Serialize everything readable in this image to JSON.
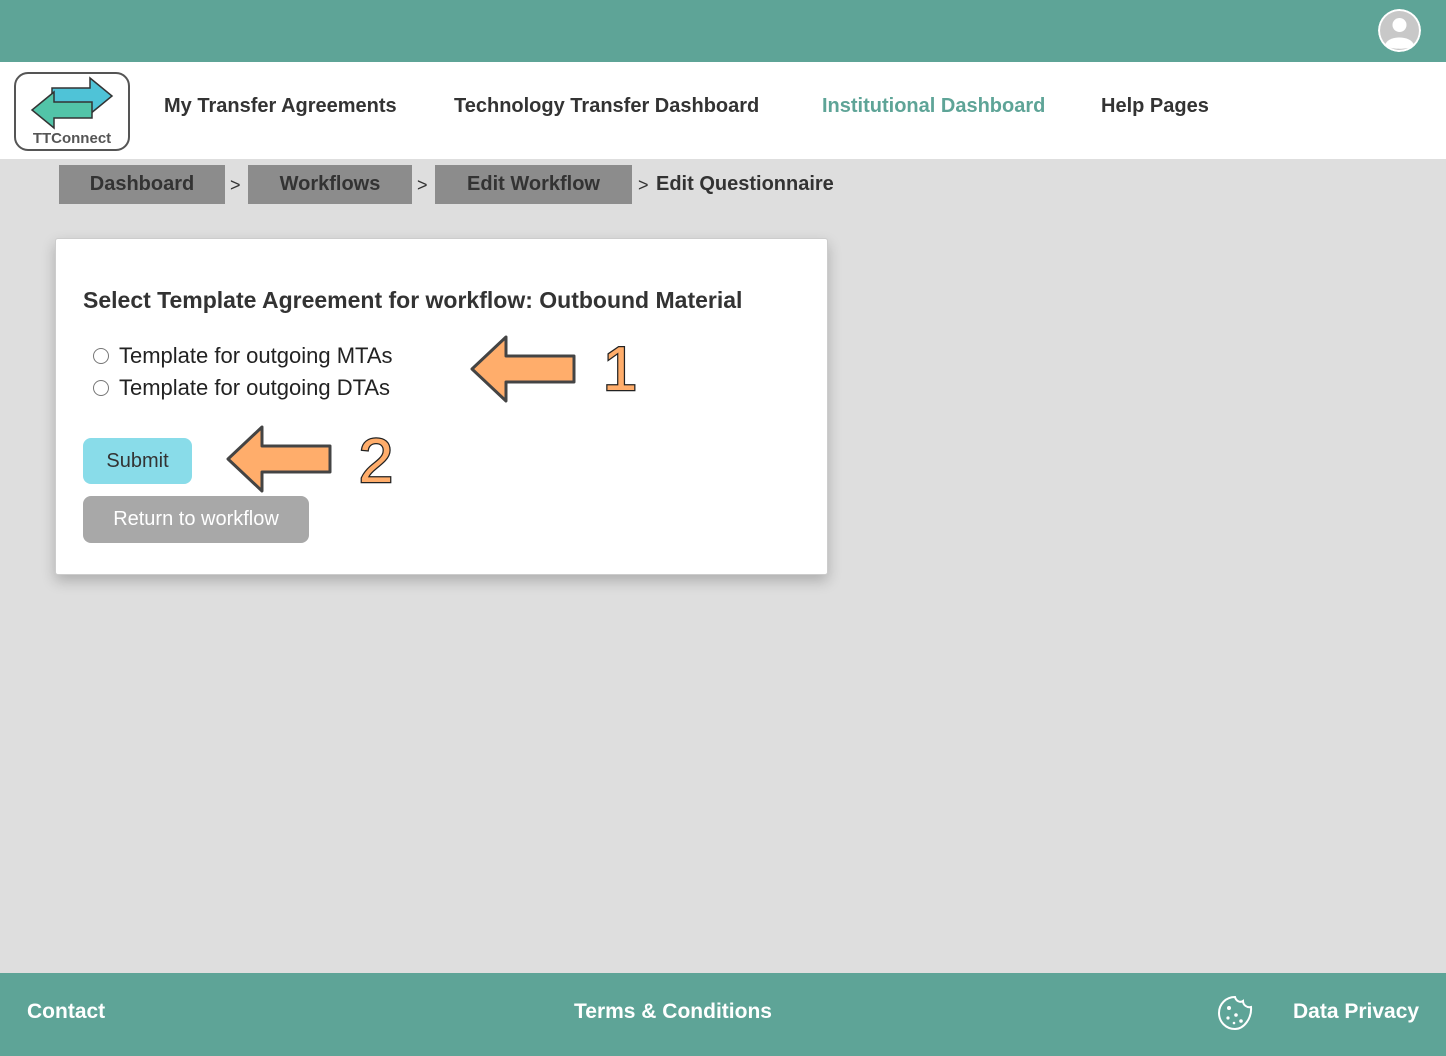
{
  "header": {
    "avatar_icon": "user-avatar-icon"
  },
  "logo": {
    "text": "TTConnect",
    "colors": {
      "arrow_top": "#4fc3d7",
      "arrow_bottom": "#52c4a8"
    }
  },
  "nav": {
    "items": [
      {
        "label": "My Transfer Agreements",
        "active": false
      },
      {
        "label": "Technology Transfer Dashboard",
        "active": false
      },
      {
        "label": "Institutional Dashboard",
        "active": true
      },
      {
        "label": "Help Pages",
        "active": false
      }
    ]
  },
  "breadcrumb": {
    "items": [
      {
        "label": "Dashboard"
      },
      {
        "label": "Workflows"
      },
      {
        "label": "Edit Workflow"
      }
    ],
    "separator": ">",
    "current": "Edit Questionnaire"
  },
  "form": {
    "title": "Select Template Agreement for workflow: Outbound Material",
    "options": [
      {
        "label": "Template for outgoing MTAs",
        "selected": false
      },
      {
        "label": "Template for outgoing DTAs",
        "selected": false
      }
    ],
    "submit_label": "Submit",
    "return_label": "Return to workflow"
  },
  "annotations": [
    {
      "number": "1"
    },
    {
      "number": "2"
    }
  ],
  "footer": {
    "contact": "Contact",
    "terms": "Terms & Conditions",
    "privacy": "Data Privacy",
    "cookie_icon": "cookie-icon"
  },
  "colors": {
    "teal": "#5ea497",
    "submit": "#89dce9",
    "return": "#a8a8a8",
    "annotation_arrow": "#ffad6b"
  }
}
